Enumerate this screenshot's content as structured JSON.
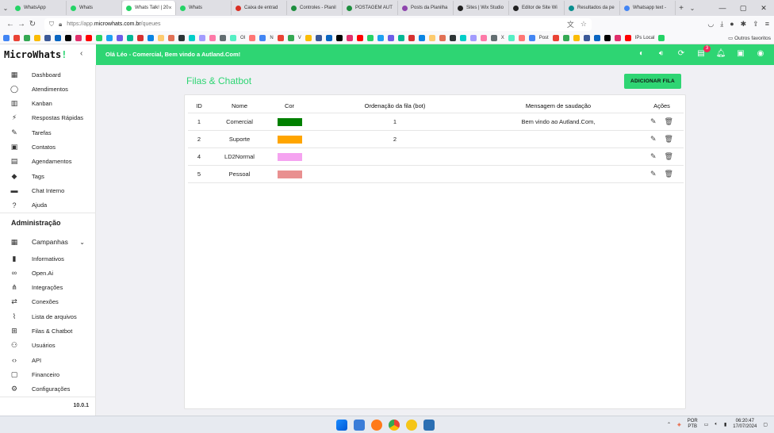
{
  "browser": {
    "tabs": [
      {
        "label": "WhatsApp",
        "color": "#25d366",
        "active": false
      },
      {
        "label": "Whats",
        "color": "#25d366",
        "active": false
      },
      {
        "label": "Whats Talk! | 20",
        "color": "#25d366",
        "active": true
      },
      {
        "label": "Whats",
        "color": "#25d366",
        "active": false
      },
      {
        "label": "Caixa de entrad",
        "color": "#d93025",
        "active": false
      },
      {
        "label": "Controles - Planil",
        "color": "#1e8e3e",
        "active": false
      },
      {
        "label": "POSTAGEM AUT",
        "color": "#1e8e3e",
        "active": false
      },
      {
        "label": "Posts da Planilha",
        "color": "#8e44ad",
        "active": false
      },
      {
        "label": "Sites | Wix Studio",
        "color": "#222222",
        "active": false
      },
      {
        "label": "Editor de Site Wi",
        "color": "#222222",
        "active": false
      },
      {
        "label": "Resultados da pe",
        "color": "#0a8f8f",
        "active": false
      },
      {
        "label": "Whatsapp text - ",
        "color": "#4285f4",
        "active": false
      }
    ],
    "url_prefix": "https://app.",
    "url_domain": "microwhats.com.br",
    "url_path": "/queues",
    "bookmarks_other": "Outros favoritos",
    "bookmark_texts": [
      "OI",
      "N",
      "V",
      "X",
      "Post",
      "IPs Local"
    ]
  },
  "header": {
    "logo_text": "MicroWhats",
    "logo_accent": "!",
    "greeting": "Olá Léo - Comercial, Bem vindo a Autland.Com!",
    "chat_badge": "3"
  },
  "sidebar": {
    "items": [
      {
        "label": "Dashboard",
        "icon": "dashboard-icon",
        "glyph": "▦"
      },
      {
        "label": "Atendimentos",
        "icon": "whatsapp-icon",
        "glyph": "◯"
      },
      {
        "label": "Kanban",
        "icon": "kanban-icon",
        "glyph": "▥"
      },
      {
        "label": "Respostas Rápidas",
        "icon": "bolt-icon",
        "glyph": "⚡"
      },
      {
        "label": "Tarefas",
        "icon": "pencil-icon",
        "glyph": "✎"
      },
      {
        "label": "Contatos",
        "icon": "contacts-icon",
        "glyph": "▣"
      },
      {
        "label": "Agendamentos",
        "icon": "calendar-icon",
        "glyph": "▤"
      },
      {
        "label": "Tags",
        "icon": "tag-icon",
        "glyph": "◆"
      },
      {
        "label": "Chat Interno",
        "icon": "chat-icon",
        "glyph": "▬"
      },
      {
        "label": "Ajuda",
        "icon": "help-icon",
        "glyph": "?"
      }
    ],
    "admin_heading": "Administração",
    "admin_items": [
      {
        "label": "Campanhas",
        "icon": "campaign-icon",
        "glyph": "▦"
      },
      {
        "label": "Informativos",
        "icon": "announcement-icon",
        "glyph": "▮"
      },
      {
        "label": "Open.Ai",
        "icon": "infinity-icon",
        "glyph": "∞"
      },
      {
        "label": "Integrações",
        "icon": "integration-icon",
        "glyph": "⋔"
      },
      {
        "label": "Conexões",
        "icon": "connections-icon",
        "glyph": "⇄"
      },
      {
        "label": "Lista de arquivos",
        "icon": "attachment-icon",
        "glyph": "⌇"
      },
      {
        "label": "Filas & Chatbot",
        "icon": "queue-icon",
        "glyph": "⊞"
      },
      {
        "label": "Usuários",
        "icon": "users-icon",
        "glyph": "⚇"
      },
      {
        "label": "API",
        "icon": "code-icon",
        "glyph": "‹›"
      },
      {
        "label": "Financeiro",
        "icon": "finance-icon",
        "glyph": "▢"
      },
      {
        "label": "Configurações",
        "icon": "gear-icon",
        "glyph": "⚙"
      }
    ],
    "version": "10.0.1"
  },
  "page": {
    "title": "Filas & Chatbot",
    "add_button": "ADICIONAR FILA",
    "columns": {
      "id": "ID",
      "nome": "Nome",
      "cor": "Cor",
      "ordenacao": "Ordenação da fila (bot)",
      "mensagem": "Mensagem de saudação",
      "acoes": "Ações"
    },
    "rows": [
      {
        "id": "1",
        "nome": "Comercial",
        "cor": "#008000",
        "ordem": "1",
        "mensagem": "Bem vindo ao Autland.Com,"
      },
      {
        "id": "2",
        "nome": "Suporte",
        "cor": "#ffa500",
        "ordem": "2",
        "mensagem": ""
      },
      {
        "id": "4",
        "nome": "LD2Normal",
        "cor": "#f5a3f0",
        "ordem": "",
        "mensagem": ""
      },
      {
        "id": "5",
        "nome": "Pessoal",
        "cor": "#e99090",
        "ordem": "",
        "mensagem": ""
      }
    ]
  },
  "taskbar": {
    "lang_top": "POR",
    "lang_bottom": "PTB",
    "time": "06:20:47",
    "date": "17/07/2024"
  },
  "colors": {
    "accent": "#2ed573",
    "badge": "#f12a5b"
  }
}
